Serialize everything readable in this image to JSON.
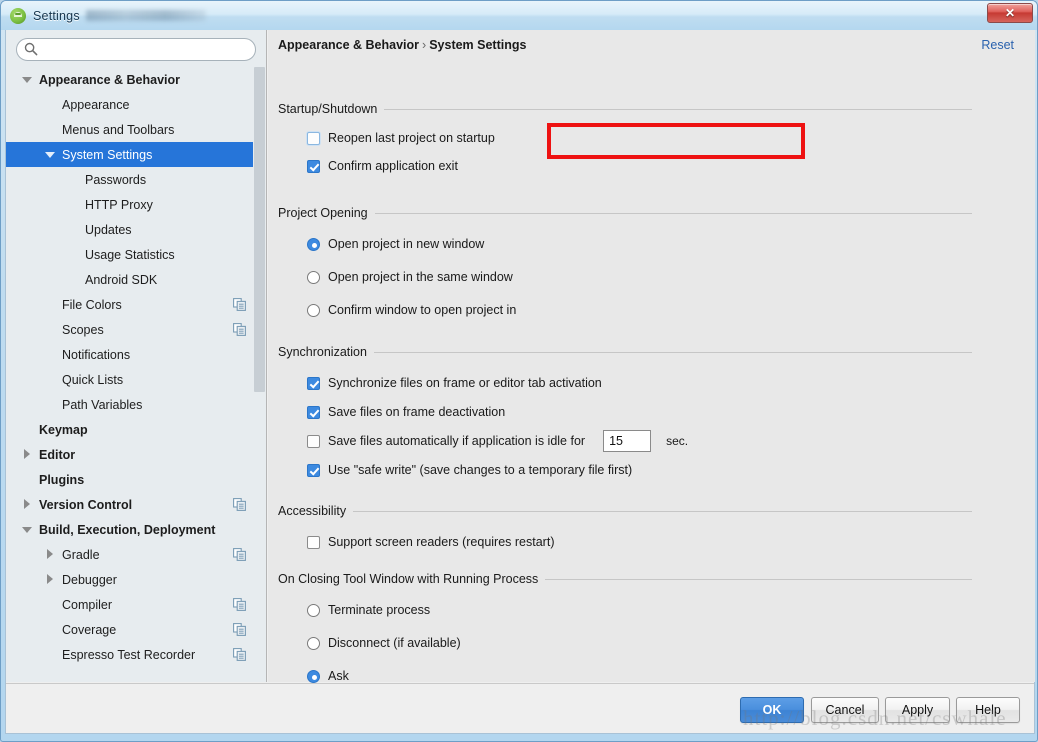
{
  "window": {
    "title": "Settings",
    "icon": "android-robot-icon",
    "close_label": "✕"
  },
  "sidebar": {
    "search": {
      "value": "",
      "placeholder": ""
    },
    "items": [
      {
        "label": "Appearance & Behavior",
        "indent": 0,
        "bold": true,
        "twisty": "down",
        "selected": false,
        "sync": false
      },
      {
        "label": "Appearance",
        "indent": 1,
        "bold": false,
        "twisty": "none",
        "selected": false,
        "sync": false
      },
      {
        "label": "Menus and Toolbars",
        "indent": 1,
        "bold": false,
        "twisty": "none",
        "selected": false,
        "sync": false
      },
      {
        "label": "System Settings",
        "indent": 1,
        "bold": false,
        "twisty": "down",
        "selected": true,
        "sync": false
      },
      {
        "label": "Passwords",
        "indent": 2,
        "bold": false,
        "twisty": "none",
        "selected": false,
        "sync": false
      },
      {
        "label": "HTTP Proxy",
        "indent": 2,
        "bold": false,
        "twisty": "none",
        "selected": false,
        "sync": false
      },
      {
        "label": "Updates",
        "indent": 2,
        "bold": false,
        "twisty": "none",
        "selected": false,
        "sync": false
      },
      {
        "label": "Usage Statistics",
        "indent": 2,
        "bold": false,
        "twisty": "none",
        "selected": false,
        "sync": false
      },
      {
        "label": "Android SDK",
        "indent": 2,
        "bold": false,
        "twisty": "none",
        "selected": false,
        "sync": false
      },
      {
        "label": "File Colors",
        "indent": 1,
        "bold": false,
        "twisty": "none",
        "selected": false,
        "sync": true
      },
      {
        "label": "Scopes",
        "indent": 1,
        "bold": false,
        "twisty": "none",
        "selected": false,
        "sync": true
      },
      {
        "label": "Notifications",
        "indent": 1,
        "bold": false,
        "twisty": "none",
        "selected": false,
        "sync": false
      },
      {
        "label": "Quick Lists",
        "indent": 1,
        "bold": false,
        "twisty": "none",
        "selected": false,
        "sync": false
      },
      {
        "label": "Path Variables",
        "indent": 1,
        "bold": false,
        "twisty": "none",
        "selected": false,
        "sync": false
      },
      {
        "label": "Keymap",
        "indent": 0,
        "bold": true,
        "twisty": "none",
        "selected": false,
        "sync": false
      },
      {
        "label": "Editor",
        "indent": 0,
        "bold": true,
        "twisty": "right",
        "selected": false,
        "sync": false
      },
      {
        "label": "Plugins",
        "indent": 0,
        "bold": true,
        "twisty": "none",
        "selected": false,
        "sync": false
      },
      {
        "label": "Version Control",
        "indent": 0,
        "bold": true,
        "twisty": "right",
        "selected": false,
        "sync": true
      },
      {
        "label": "Build, Execution, Deployment",
        "indent": 0,
        "bold": true,
        "twisty": "down",
        "selected": false,
        "sync": false
      },
      {
        "label": "Gradle",
        "indent": 1,
        "bold": false,
        "twisty": "right",
        "selected": false,
        "sync": true
      },
      {
        "label": "Debugger",
        "indent": 1,
        "bold": false,
        "twisty": "right",
        "selected": false,
        "sync": false
      },
      {
        "label": "Compiler",
        "indent": 1,
        "bold": false,
        "twisty": "none",
        "selected": false,
        "sync": true
      },
      {
        "label": "Coverage",
        "indent": 1,
        "bold": false,
        "twisty": "none",
        "selected": false,
        "sync": true
      },
      {
        "label": "Espresso Test Recorder",
        "indent": 1,
        "bold": false,
        "twisty": "none",
        "selected": false,
        "sync": true
      }
    ]
  },
  "content": {
    "breadcrumb_root": "Appearance & Behavior",
    "breadcrumb_sep": "›",
    "breadcrumb_leaf": "System Settings",
    "reset_label": "Reset",
    "sections": {
      "startup": {
        "title": "Startup/Shutdown",
        "options": [
          {
            "label": "Reopen last project on startup",
            "type": "checkbox",
            "checked": false,
            "focused": true
          },
          {
            "label": "Confirm application exit",
            "type": "checkbox",
            "checked": true,
            "focused": false
          }
        ]
      },
      "project_opening": {
        "title": "Project Opening",
        "options": [
          {
            "label": "Open project in new window",
            "type": "radio",
            "checked": true
          },
          {
            "label": "Open project in the same window",
            "type": "radio",
            "checked": false
          },
          {
            "label": "Confirm window to open project in",
            "type": "radio",
            "checked": false
          }
        ]
      },
      "synchronization": {
        "title": "Synchronization",
        "options": [
          {
            "label": "Synchronize files on frame or editor tab activation",
            "type": "checkbox",
            "checked": true
          },
          {
            "label": "Save files on frame deactivation",
            "type": "checkbox",
            "checked": true
          },
          {
            "label": "Save files automatically if application is idle for",
            "type": "checkbox",
            "checked": false
          },
          {
            "label": "Use \"safe write\" (save changes to a temporary file first)",
            "type": "checkbox",
            "checked": true
          }
        ],
        "idle_value": "15",
        "idle_suffix": "sec."
      },
      "accessibility": {
        "title": "Accessibility",
        "options": [
          {
            "label": "Support screen readers (requires restart)",
            "type": "checkbox",
            "checked": false
          }
        ]
      },
      "closing_tool_window": {
        "title": "On Closing Tool Window with Running Process",
        "options": [
          {
            "label": "Terminate process",
            "type": "radio",
            "checked": false
          },
          {
            "label": "Disconnect (if available)",
            "type": "radio",
            "checked": false
          },
          {
            "label": "Ask",
            "type": "radio",
            "checked": true
          }
        ]
      }
    }
  },
  "buttons": {
    "ok": "OK",
    "cancel": "Cancel",
    "apply": "Apply",
    "help": "Help"
  },
  "watermark": "http://blog.csdn.net/cswhale",
  "colors": {
    "accent": "#2675d9",
    "checkbox_checked": "#3d8ae0",
    "highlight_box": "#ee1111",
    "link": "#2a62ae",
    "panel_bg": "#e8e8e8",
    "sidebar_bg": "#e7ecef"
  }
}
